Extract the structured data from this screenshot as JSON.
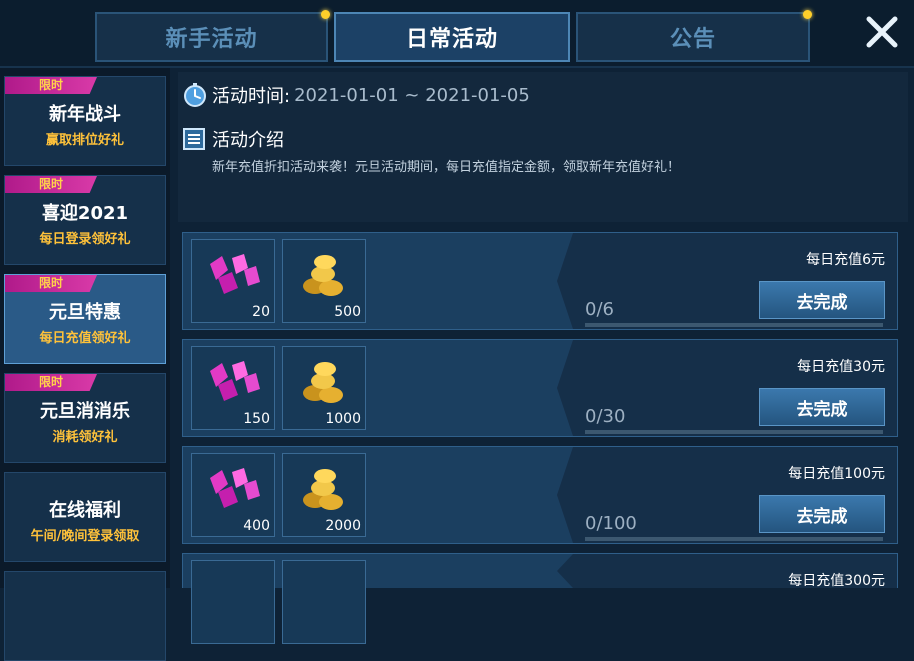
{
  "tabs": [
    {
      "label": "新手活动",
      "has_notice": true
    },
    {
      "label": "日常活动",
      "has_notice": false,
      "active": true
    },
    {
      "label": "公告",
      "has_notice": true
    }
  ],
  "sidebar": {
    "items": [
      {
        "tag": "限时",
        "title": "新年战斗",
        "subtitle": "赢取排位好礼"
      },
      {
        "tag": "限时",
        "title": "喜迎2021",
        "subtitle": "每日登录领好礼"
      },
      {
        "tag": "限时",
        "title": "元旦特惠",
        "subtitle": "每日充值领好礼",
        "active": true
      },
      {
        "tag": "限时",
        "title": "元旦消消乐",
        "subtitle": "消耗领好礼"
      },
      {
        "tag": "",
        "title": "在线福利",
        "subtitle": "午间/晚间登录领取"
      }
    ]
  },
  "info": {
    "time_label": "活动时间:",
    "time_value": "2021-01-01 ~ 2021-01-05",
    "intro_label": "活动介绍",
    "intro_text": "新年充值折扣活动来袭！元旦活动期间，每日充值指定金额，领取新年充值好礼！"
  },
  "rewards": [
    {
      "label": "每日充值6元",
      "gems": "20",
      "coins": "500",
      "progress": "0/6",
      "button": "去完成"
    },
    {
      "label": "每日充值30元",
      "gems": "150",
      "coins": "1000",
      "progress": "0/30",
      "button": "去完成"
    },
    {
      "label": "每日充值100元",
      "gems": "400",
      "coins": "2000",
      "progress": "0/100",
      "button": "去完成"
    },
    {
      "label": "每日充值300元"
    }
  ],
  "colors": {
    "accent": "#ffc23a",
    "tag": "#d93aa8",
    "notice_dot": "#ffcf2a"
  },
  "icons": {
    "close": "close-icon",
    "timer": "stopwatch-icon",
    "intro": "document-list-icon",
    "gem": "gem-icon",
    "coin": "coin-icon"
  }
}
